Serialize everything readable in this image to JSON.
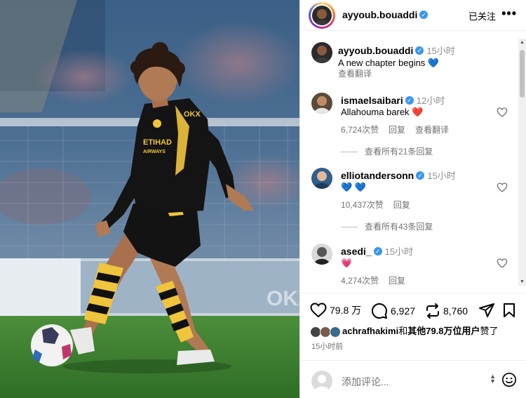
{
  "post": {
    "author": "ayyoub.bouaddi",
    "follow_status": "已关注",
    "more": "•••",
    "caption_time": "15小时",
    "caption": "A new chapter begins 💙",
    "caption_translate": "查看翻译"
  },
  "photo": {
    "shirt_text_1": "OKX",
    "shirt_text_2": "ETIHAD",
    "shirt_text_3": "AIRWAYS",
    "banner_text": "OKX"
  },
  "comments": [
    {
      "user": "ismaelsaibari",
      "verified": true,
      "time": "12小时",
      "text": "Allahouma barek ❤️",
      "likes": "6,724次赞",
      "reply": "回复",
      "translate": "查看翻译",
      "view_replies": "查看所有21条回复"
    },
    {
      "user": "elliotandersonn",
      "verified": true,
      "time": "15小时",
      "text": "💙 💙",
      "likes": "10,437次赞",
      "reply": "回复",
      "view_replies": "查看所有43条回复"
    },
    {
      "user": "asedi_",
      "verified": true,
      "time": "15小时",
      "text": "💗",
      "likes": "4,274次赞",
      "reply": "回复"
    }
  ],
  "actions": {
    "like_count": "79.8 万",
    "comment_count": "6,927",
    "repost_count": "8,760"
  },
  "liked_by": {
    "user": "achrafhakimi",
    "conj": "和",
    "rest": "其他79.8万位用户",
    "suffix": "赞了"
  },
  "posted_ago": "15小时前",
  "add_comment_placeholder": "添加评论...",
  "colors": {
    "verified": "#3897f0",
    "heart_red": "#ed4956",
    "secondary_text": "#737373"
  }
}
